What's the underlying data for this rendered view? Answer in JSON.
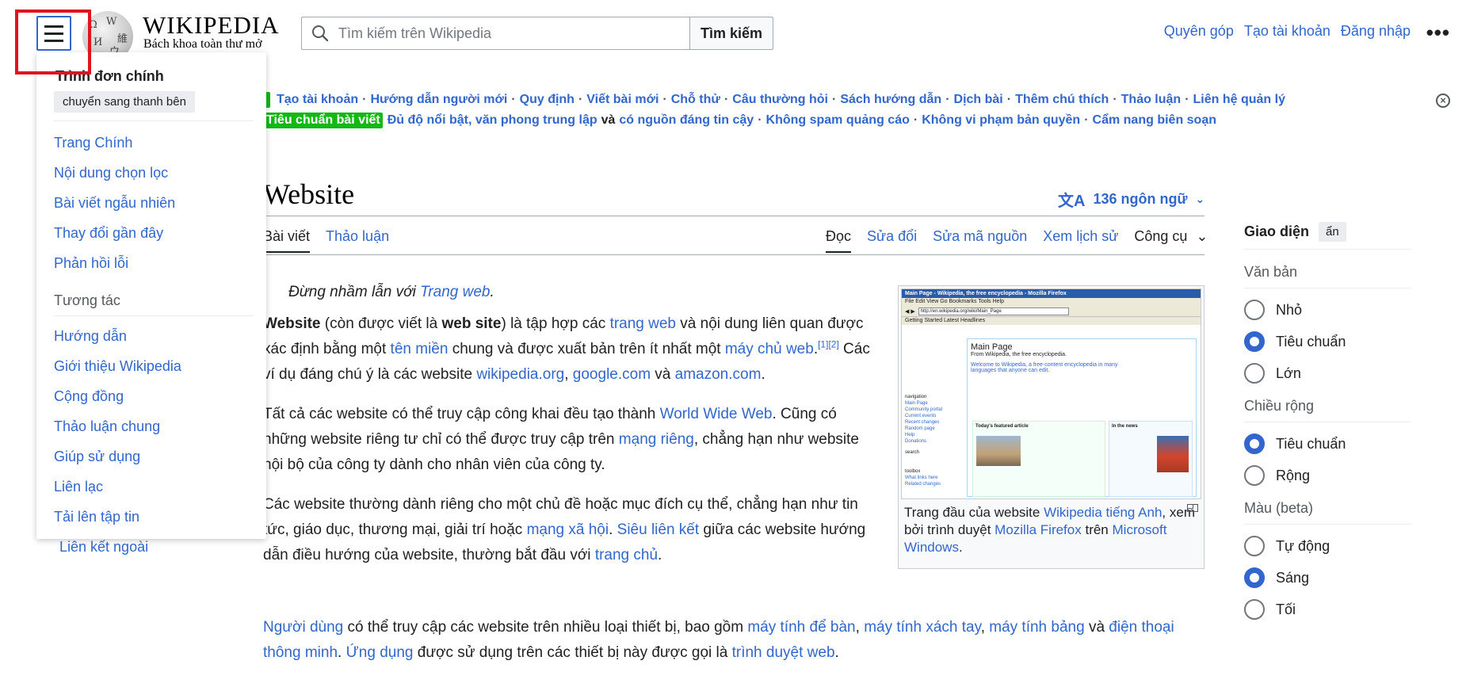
{
  "header": {
    "logo_wordmark": "WIKIPEDIA",
    "logo_tagline": "Bách khoa toàn thư mở",
    "search_placeholder": "Tìm kiếm trên Wikipedia",
    "search_button": "Tìm kiếm",
    "user_links": [
      "Quyên góp",
      "Tạo tài khoản",
      "Đăng nhập"
    ],
    "more_label": "•••"
  },
  "main_menu": {
    "title": "Trình đơn chính",
    "move_button": "chuyển sang thanh bên",
    "nav_items": [
      "Trang Chính",
      "Nội dung chọn lọc",
      "Bài viết ngẫu nhiên",
      "Thay đổi gần đây",
      "Phản hồi lỗi"
    ],
    "interaction_heading": "Tương tác",
    "interaction_items": [
      "Hướng dẫn",
      "Giới thiệu Wikipedia",
      "Cộng đồng",
      "Thảo luận chung",
      "Giúp sử dụng",
      "Liên lạc",
      "Tải lên tập tin"
    ]
  },
  "stray_link": "Liên kết ngoài",
  "site_notice": {
    "row1": [
      "Tạo tài khoản",
      "Hướng dẫn người mới",
      "Quy định",
      "Viết bài mới",
      "Chỗ thử",
      "Câu thường hỏi",
      "Sách hướng dẫn",
      "Dịch bài",
      "Thêm chú thích",
      "Thảo luận",
      "Liên hệ quản lý"
    ],
    "badge": "Tiêu chuẩn bài viết",
    "row2_a": "Đủ độ nổi bật, văn phong trung lập",
    "row2_and": "và",
    "row2_b": "có nguồn đáng tin cậy",
    "row2_rest": [
      "Không spam quảng cáo",
      "Không vi phạm bản quyền",
      "Cẩm nang biên soạn"
    ],
    "close_label": "×"
  },
  "article": {
    "title": "Website",
    "languages": "136 ngôn ngữ",
    "tabs_left": [
      "Bài viết",
      "Thảo luận"
    ],
    "tabs_right": [
      "Đọc",
      "Sửa đổi",
      "Sửa mã nguồn",
      "Xem lịch sử",
      "Công cụ"
    ],
    "hatnote_prefix": "Đừng nhầm lẫn với",
    "hatnote_link": "Trang web",
    "p1": {
      "b1": "Website",
      "t1": " (còn được viết là ",
      "b2": "web site",
      "t2": ") là tập hợp các ",
      "l1": "trang web",
      "t3": " và nội dung liên quan được xác định bằng một ",
      "l2": "tên miền",
      "t4": " chung và được xuất bản trên ít nhất một ",
      "l3": "máy chủ web",
      "ref1": "[1]",
      "ref2": "[2]",
      "t5": " Các ví dụ đáng chú ý là các website ",
      "l4": "wikipedia.org",
      "t6": ", ",
      "l5": "google.com",
      "t7": " và ",
      "l6": "amazon.com",
      "t8": "."
    },
    "p2": {
      "t1": "Tất cả các website có thể truy cập công khai đều tạo thành ",
      "l1": "World Wide Web",
      "t2": ". Cũng có những website riêng tư chỉ có thể được truy cập trên ",
      "l2": "mạng riêng",
      "t3": ", chẳng hạn như website nội bộ của công ty dành cho nhân viên của công ty."
    },
    "p3": {
      "t1": "Các website thường dành riêng cho một chủ đề hoặc mục đích cụ thể, chẳng hạn như tin tức, giáo dục, thương mại, giải trí hoặc ",
      "l1": "mạng xã hội",
      "t2": ". ",
      "l2": "Siêu liên kết",
      "t3": " giữa các website hướng dẫn điều hướng của website, thường bắt đầu với ",
      "l3": "trang chủ",
      "t4": "."
    },
    "p4": {
      "l1": "Người dùng",
      "t1": " có thể truy cập các website trên nhiều loại thiết bị, bao gồm ",
      "l2": "máy tính để bàn",
      "t2": ", ",
      "l3": "máy tính xách tay",
      "t3": ", ",
      "l4": "máy tính bảng",
      "t4": " và ",
      "l5": "điện thoại thông minh",
      "t5": ". ",
      "l6": "Ứng dụng",
      "t6": " được sử dụng trên các thiết bị này được gọi là ",
      "l7": "trình duyệt web",
      "t7": "."
    }
  },
  "thumbnail": {
    "shot": {
      "titlebar": "Main Page - Wikipedia, the free encyclopedia - Mozilla Firefox",
      "menubar": "File  Edit  View  Go  Bookmarks  Tools  Help",
      "url": "http://en.wikipedia.org/wiki/Main_Page",
      "bookmarks": "Getting Started   Latest Headlines",
      "heading": "Main Page",
      "sub": "From Wikipedia, the free encyclopedia.",
      "welcome": "Welcome to Wikipedia, a free-content encyclopedia in many languages that anyone can edit.",
      "featured_title": "Today's featured article",
      "news_title": "In the news",
      "side_links": [
        "navigation",
        "Main Page",
        "Community portal",
        "Current events",
        "Recent changes",
        "Random page",
        "Help",
        "Donations",
        "search",
        "toolbox",
        "What links here",
        "Related changes"
      ]
    },
    "caption": {
      "t1": "Trang đầu của website ",
      "l1": "Wikipedia tiếng Anh",
      "t2": ", xem bởi trình duyệt ",
      "l2": "Mozilla Firefox",
      "t3": " trên ",
      "l3": "Microsoft Windows",
      "t4": "."
    }
  },
  "appearance": {
    "title": "Giao diện",
    "hide": "ẩn",
    "text_heading": "Văn bản",
    "text_options": [
      "Nhỏ",
      "Tiêu chuẩn",
      "Lớn"
    ],
    "text_selected": "Tiêu chuẩn",
    "width_heading": "Chiều rộng",
    "width_options": [
      "Tiêu chuẩn",
      "Rộng"
    ],
    "width_selected": "Tiêu chuẩn",
    "color_heading": "Màu (beta)",
    "color_options": [
      "Tự động",
      "Sáng",
      "Tối"
    ],
    "color_selected": "Sáng"
  },
  "colors": {
    "link": "#3366cc",
    "highlight_box": "#e0141e",
    "notice_badge": "#14b814",
    "radio_selected": "#3366cc"
  }
}
